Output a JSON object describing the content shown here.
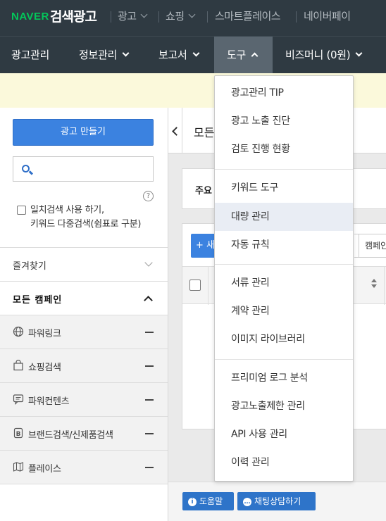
{
  "brand": {
    "naver": "NAVER",
    "title": "검색광고"
  },
  "top_nav": [
    {
      "label": "광고"
    },
    {
      "label": "쇼핑"
    },
    {
      "label": "스마트플레이스"
    },
    {
      "label": "네이버페이"
    }
  ],
  "main_nav": [
    {
      "label": "광고관리"
    },
    {
      "label": "정보관리"
    },
    {
      "label": "보고서"
    },
    {
      "label": "도구"
    },
    {
      "label": "비즈머니 (0원)"
    }
  ],
  "sidebar": {
    "create_button": "광고 만들기",
    "search_placeholder": "",
    "help": "?",
    "exact_search_line1": "일치검색 사용 하기,",
    "exact_search_line2": "키워드 다중검색(쉼표로 구분)",
    "favorites": "즐겨찾기",
    "all_campaigns": "모든 캠페인",
    "campaigns": [
      {
        "label": "파워링크",
        "icon": "globe-icon"
      },
      {
        "label": "쇼핑검색",
        "icon": "shopping-bag-icon"
      },
      {
        "label": "파워컨텐츠",
        "icon": "chat-icon"
      },
      {
        "label": "브랜드검색/신제품검색",
        "icon": "brand-icon"
      },
      {
        "label": "플레이스",
        "icon": "map-icon"
      }
    ]
  },
  "content": {
    "title": "모든",
    "card_label": "주요",
    "add_button": "+ 새",
    "filter_button": "캠페인"
  },
  "footer": {
    "help_button": "도움말",
    "chat_button": "채팅상담하기"
  },
  "dropdown": {
    "groups": [
      [
        "광고관리 TIP",
        "광고 노출 진단",
        "검토 진행 현황"
      ],
      [
        "키워드 도구",
        "대량 관리",
        "자동 규칙"
      ],
      [
        "서류 관리",
        "계약 관리",
        "이미지 라이브러리"
      ],
      [
        "프리미엄 로그 분석",
        "광고노출제한 관리",
        "API 사용 관리",
        "이력 관리"
      ]
    ],
    "highlighted": "대량 관리"
  },
  "colors": {
    "accent": "#3b82e0",
    "nav_bg": "#2f3a42",
    "brand_green": "#03c75a"
  }
}
